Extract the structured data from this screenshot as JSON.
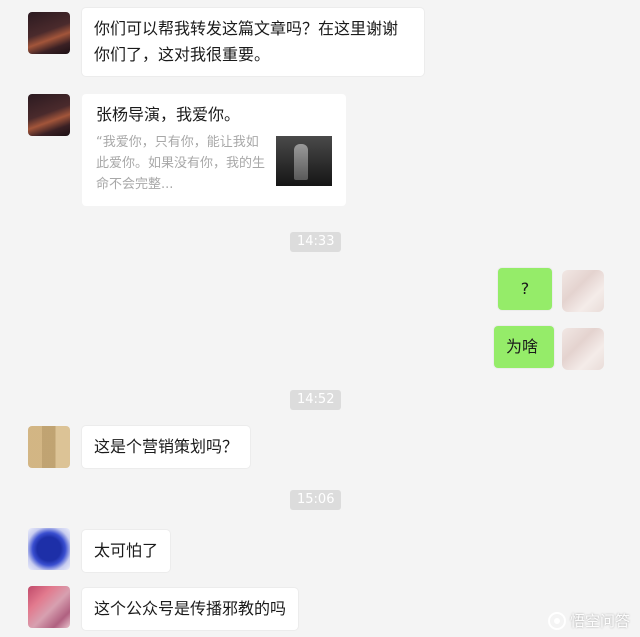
{
  "messages": {
    "m1": "你们可以帮我转发这篇文章吗？在这里谢谢你们了，这对我很重要。",
    "m3": "?",
    "m4": "为啥",
    "m5": "这是个营销策划吗？",
    "m6": "太可怕了",
    "m7": "这个公众号是传播邪教的吗"
  },
  "article_card": {
    "title": "张杨导演，我爱你。",
    "description": "“我爱你，只有你，能让我如此爱你。如果没有你，我的生命不会完整..."
  },
  "timestamps": [
    "14:33",
    "14:52",
    "15:06"
  ],
  "watermark": {
    "text": "悟空问答",
    "icon": "wukong-logo-icon"
  },
  "colors": {
    "chat_bg": "#f4f4f4",
    "my_bubble": "#95ec69",
    "their_bubble": "#ffffff",
    "time_badge": "#dcdcdc"
  }
}
